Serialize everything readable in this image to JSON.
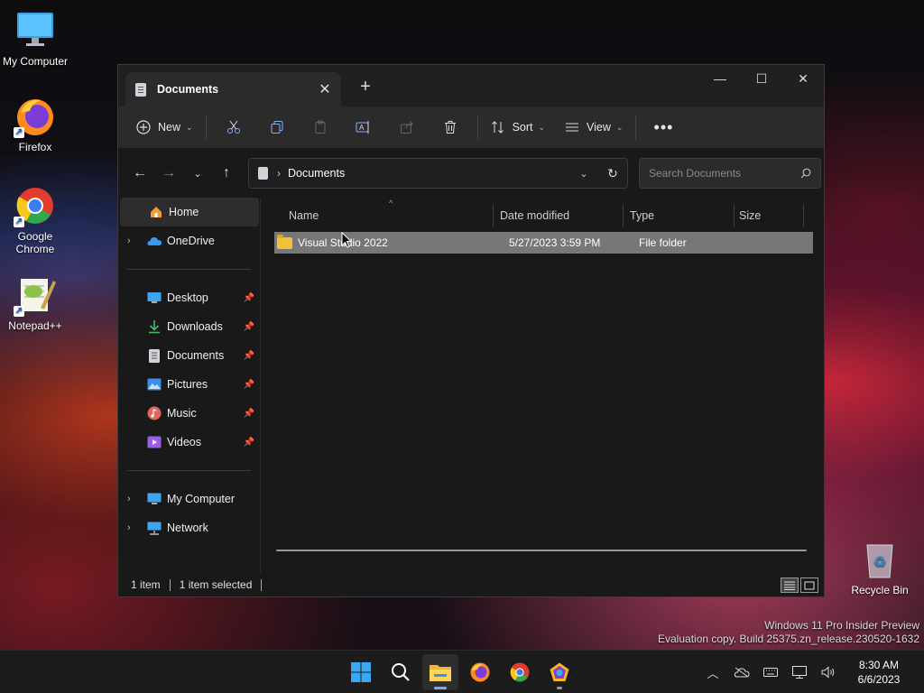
{
  "desktop": {
    "icons": [
      {
        "label": "My Computer"
      },
      {
        "label": "Firefox"
      },
      {
        "label": "Google Chrome"
      },
      {
        "label": "Notepad++"
      },
      {
        "label": "Recycle Bin"
      }
    ],
    "watermark": {
      "line1": "Windows 11 Pro Insider Preview",
      "line2": "Evaluation copy. Build 25375.zn_release.230520-1632"
    }
  },
  "window": {
    "tab_title": "Documents",
    "toolbar": {
      "new_label": "New",
      "sort_label": "Sort",
      "view_label": "View"
    },
    "address": {
      "crumb": "Documents",
      "search_placeholder": "Search Documents"
    },
    "nav": {
      "home": "Home",
      "onedrive": "OneDrive",
      "quick": [
        {
          "label": "Desktop",
          "icon": "desktop-icon"
        },
        {
          "label": "Downloads",
          "icon": "download-icon"
        },
        {
          "label": "Documents",
          "icon": "document-icon"
        },
        {
          "label": "Pictures",
          "icon": "pictures-icon"
        },
        {
          "label": "Music",
          "icon": "music-icon"
        },
        {
          "label": "Videos",
          "icon": "videos-icon"
        }
      ],
      "my_computer": "My Computer",
      "network": "Network"
    },
    "columns": [
      "Name",
      "Date modified",
      "Type",
      "Size"
    ],
    "files": [
      {
        "name": "Visual Studio 2022",
        "date": "5/27/2023 3:59 PM",
        "type": "File folder",
        "size": ""
      }
    ],
    "status": {
      "count": "1 item",
      "selected": "1 item selected"
    }
  },
  "taskbar": {
    "time": "8:30 AM",
    "date": "6/6/2023"
  }
}
